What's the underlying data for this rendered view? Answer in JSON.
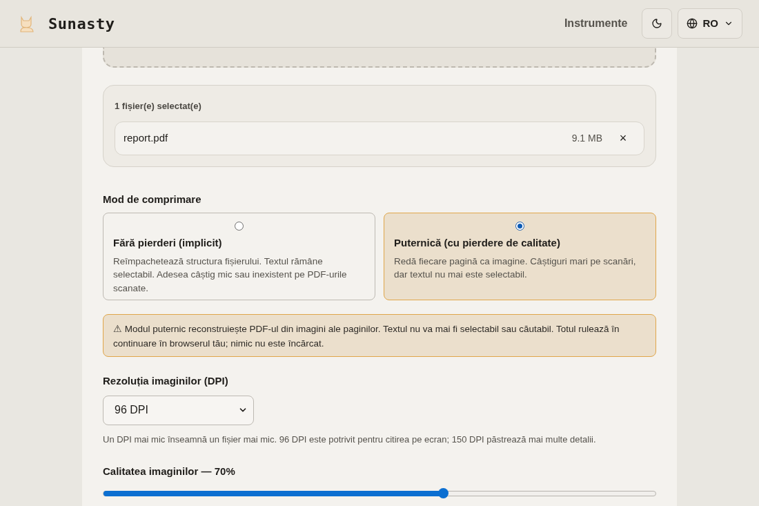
{
  "header": {
    "brand": "Sunasty",
    "nav_link": "Instrumente",
    "language": "RO"
  },
  "files": {
    "heading": "1 fișier(e) selectat(e)",
    "items": [
      {
        "name": "report.pdf",
        "size": "9.1 MB",
        "remove": "×"
      }
    ]
  },
  "mode": {
    "label": "Mod de comprimare",
    "options": [
      {
        "title": "Fără pierderi (implicit)",
        "description": "Reîmpachetează structura fișierului. Textul rămâne selectabil. Adesea câștig mic sau inexistent pe PDF-urile scanate.",
        "selected": false
      },
      {
        "title": "Puternică (cu pierdere de calitate)",
        "description": "Redă fiecare pagină ca imagine. Câștiguri mari pe scanări, dar textul nu mai este selectabil.",
        "selected": true
      }
    ]
  },
  "warning": "⚠ Modul puternic reconstruiește PDF-ul din imagini ale paginilor. Textul nu va mai fi selectabil sau căutabil. Totul rulează în continuare în browserul tău; nimic nu este încărcat.",
  "dpi": {
    "label": "Rezoluția imaginilor (DPI)",
    "value": "96 DPI",
    "hint": "Un DPI mai mic înseamnă un fișier mai mic. 96 DPI este potrivit pentru citirea pe ecran; 150 DPI păstrează mai multe detalii."
  },
  "quality": {
    "label": "Calitatea imaginilor — 70%",
    "level": 0.615
  }
}
